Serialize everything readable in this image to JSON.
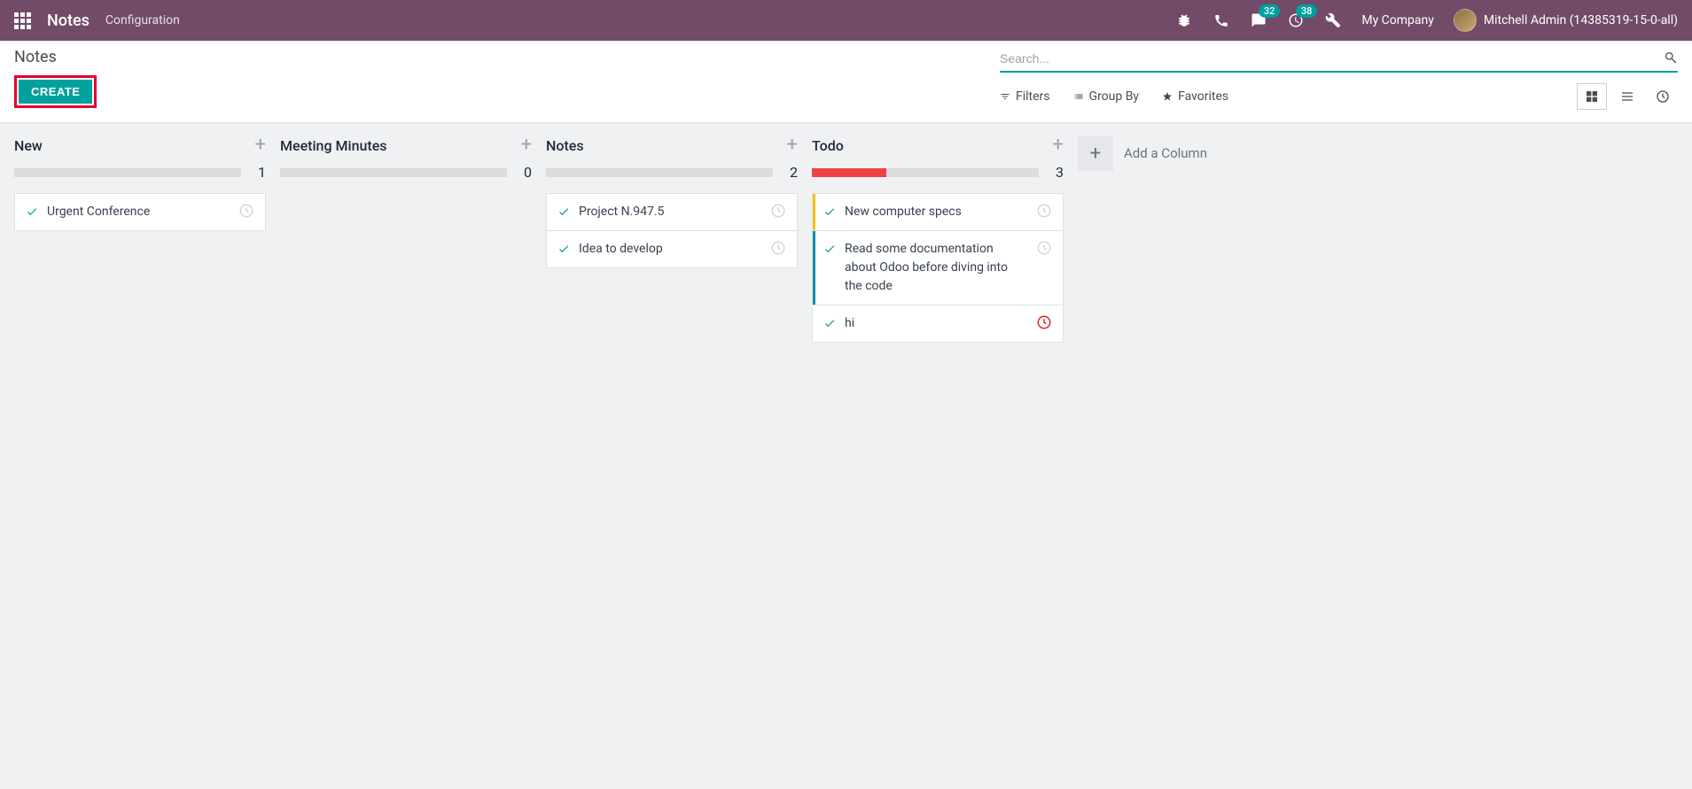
{
  "navbar": {
    "brand": "Notes",
    "config_link": "Configuration",
    "messages_badge": "32",
    "activities_badge": "38",
    "company": "My Company",
    "user": "Mitchell Admin (14385319-15-0-all)"
  },
  "control": {
    "breadcrumb": "Notes",
    "create_label": "CREATE",
    "search_placeholder": "Search...",
    "filters_label": "Filters",
    "groupby_label": "Group By",
    "favorites_label": "Favorites"
  },
  "columns": [
    {
      "title": "New",
      "count": "1",
      "progress_pct": 0,
      "cards": [
        {
          "title": "Urgent Conference",
          "bar_color": "",
          "clock": "gray"
        }
      ]
    },
    {
      "title": "Meeting Minutes",
      "count": "0",
      "progress_pct": 0,
      "cards": []
    },
    {
      "title": "Notes",
      "count": "2",
      "progress_pct": 0,
      "cards": [
        {
          "title": "Project N.947.5",
          "bar_color": "",
          "clock": "gray"
        },
        {
          "title": "Idea to develop",
          "bar_color": "",
          "clock": "gray"
        }
      ]
    },
    {
      "title": "Todo",
      "count": "3",
      "progress_pct": 33,
      "cards": [
        {
          "title": "New computer specs",
          "bar_color": "#f5c518",
          "clock": "gray"
        },
        {
          "title": "Read some documentation about Odoo before diving into the code",
          "bar_color": "#0891b2",
          "clock": "gray"
        },
        {
          "title": "hi",
          "bar_color": "",
          "clock": "red"
        }
      ]
    }
  ],
  "add_column_label": "Add a Column"
}
